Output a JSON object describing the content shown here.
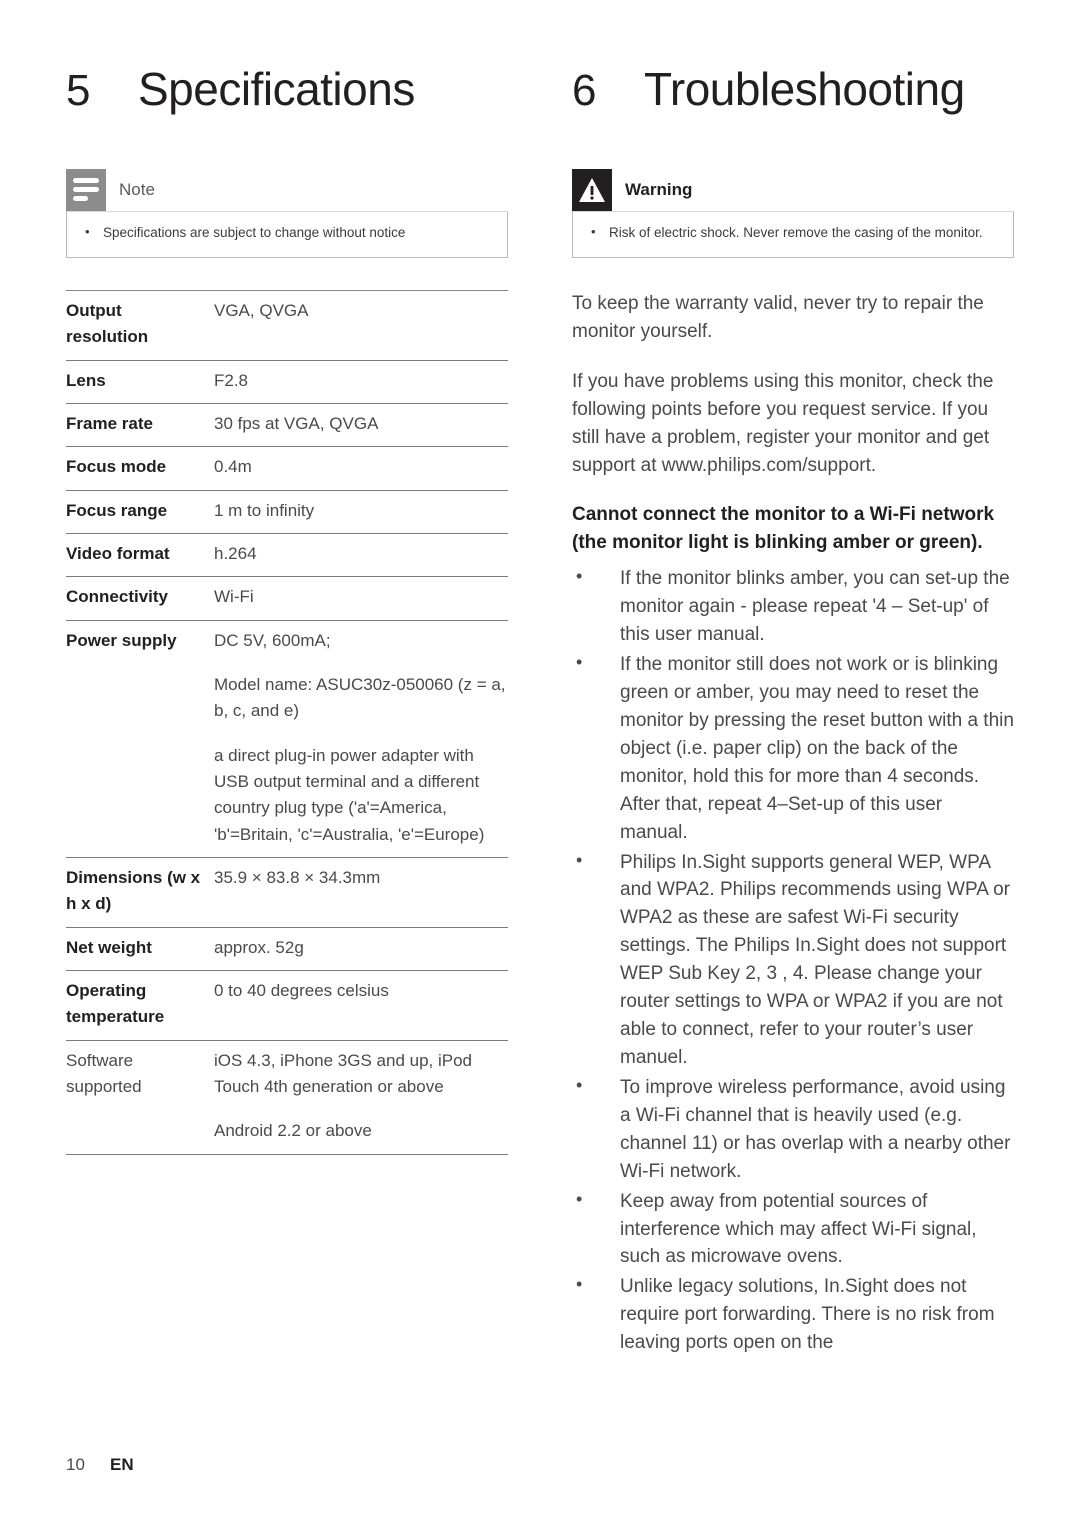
{
  "left": {
    "chapter": {
      "number": "5",
      "title": "Specifications"
    },
    "note": {
      "icon": "note-icon",
      "label": "Note",
      "items": [
        "Specifications are subject to change without notice"
      ]
    },
    "spec_table": {
      "rows": [
        {
          "key": "Output resolution",
          "key_bold": true,
          "values": [
            "VGA, QVGA"
          ]
        },
        {
          "key": "Lens",
          "key_bold": true,
          "values": [
            "F2.8"
          ]
        },
        {
          "key": "Frame rate",
          "key_bold": true,
          "values": [
            "30 fps at VGA, QVGA"
          ]
        },
        {
          "key": "Focus mode",
          "key_bold": true,
          "values": [
            "0.4m"
          ]
        },
        {
          "key": "Focus range",
          "key_bold": true,
          "values": [
            "1 m to infinity"
          ]
        },
        {
          "key": "Video format",
          "key_bold": true,
          "values": [
            "h.264"
          ]
        },
        {
          "key": "Connectivity",
          "key_bold": true,
          "values": [
            "Wi-Fi"
          ]
        },
        {
          "key": "Power supply",
          "key_bold": true,
          "values": [
            "DC 5V, 600mA;",
            "Model name: ASUC30z-050060 (z = a, b, c, and e)",
            "a direct plug-in power adapter with USB output terminal and a different country plug type ('a'=America, 'b'=Britain, 'c'=Australia, 'e'=Europe)"
          ]
        },
        {
          "key": "Dimensions (w x h x d)",
          "key_bold": true,
          "values": [
            "35.9 × 83.8 × 34.3mm"
          ]
        },
        {
          "key": "Net weight",
          "key_bold": true,
          "values": [
            "approx. 52g"
          ]
        },
        {
          "key": "Operating temperature",
          "key_bold": true,
          "values": [
            "0 to 40 degrees celsius"
          ]
        },
        {
          "key": "Software supported",
          "key_bold": false,
          "values": [
            "iOS 4.3, iPhone 3GS and up, iPod Touch 4th generation or above",
            "Android 2.2 or above"
          ]
        }
      ]
    }
  },
  "right": {
    "chapter": {
      "number": "6",
      "title": "Troubleshooting"
    },
    "warning": {
      "icon": "warning-icon",
      "label": "Warning",
      "items": [
        "Risk of electric shock. Never remove the casing of the monitor."
      ]
    },
    "paragraphs": [
      "To keep the warranty valid, never try to repair the monitor yourself.",
      "If you have problems using this monitor, check the following points before you request service. If you still have a problem, register your monitor and get support at www.philips.com/support."
    ],
    "subheading": "Cannot connect the monitor to a Wi-Fi network (the monitor light is blinking amber or green).",
    "tips": [
      "If the monitor blinks amber, you can set-up the monitor again - please repeat '4 – Set-up' of this user manual.",
      "If the monitor still does not work or is blinking green or amber, you may need to reset the monitor by pressing the reset button with a thin object (i.e. paper clip) on the back of the monitor, hold this for more than 4 seconds. After that, repeat 4–Set-up of this user manual.",
      "Philips In.Sight supports general WEP, WPA and WPA2. Philips recommends using WPA or WPA2 as these are safest Wi-Fi security settings. The Philips In.Sight does not support WEP Sub Key 2, 3 , 4. Please change your router settings to WPA or WPA2 if you are not able to connect, refer to your router’s user manuel.",
      "To improve wireless performance, avoid using a Wi-Fi channel that is heavily used (e.g. channel 11) or has overlap with a nearby other Wi-Fi network.",
      "Keep away from potential sources of interference which may affect Wi-Fi signal, such as microwave ovens.",
      "Unlike legacy solutions, In.Sight does not require port forwarding. There is no risk from leaving ports open on the"
    ]
  },
  "footer": {
    "page_number": "10",
    "language": "EN"
  },
  "colors": {
    "text": "#231f20",
    "body_text": "#4a4a4c",
    "note_icon_bg": "#8c8c8e",
    "warning_icon_bg": "#231f20",
    "rule": "#7b7b7f"
  }
}
